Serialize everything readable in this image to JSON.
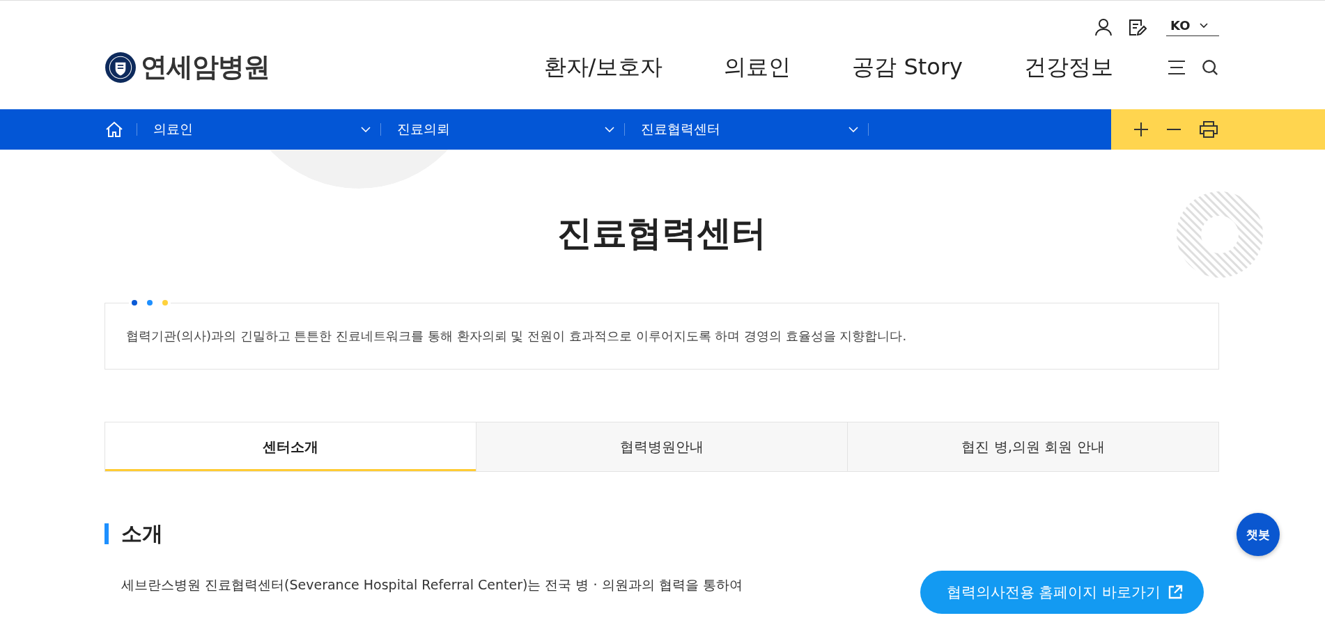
{
  "header": {
    "logo_text": "연세암병원",
    "language": "KO",
    "nav": [
      "환자/보호자",
      "의료인",
      "공감 Story",
      "건강정보"
    ]
  },
  "breadcrumb": [
    "의료인",
    "진료의뢰",
    "진료협력센터"
  ],
  "page_title": "진료협력센터",
  "intro": {
    "dots": [
      {
        "color": "#0a5ad6"
      },
      {
        "color": "#1e90ff"
      },
      {
        "color": "#ffd23c"
      }
    ],
    "text": "협력기관(의사)과의 긴밀하고 튼튼한 진료네트워크를 통해 환자의뢰 및 전원이 효과적으로 이루어지도록 하며 경영의 효율성을 지향합니다."
  },
  "tabs": [
    {
      "label": "센터소개",
      "selected": true
    },
    {
      "label": "협력병원안내",
      "selected": false
    },
    {
      "label": "협진 병,의원 회원 안내",
      "selected": false
    }
  ],
  "section": {
    "heading": "소개",
    "text": "세브란스병원 진료협력센터(Severance Hospital Referral Center)는 전국 병 · 의원과의 협력을 통하여",
    "link_button": "협력의사전용 홈페이지 바로가기"
  },
  "chatbot": "챗봇"
}
